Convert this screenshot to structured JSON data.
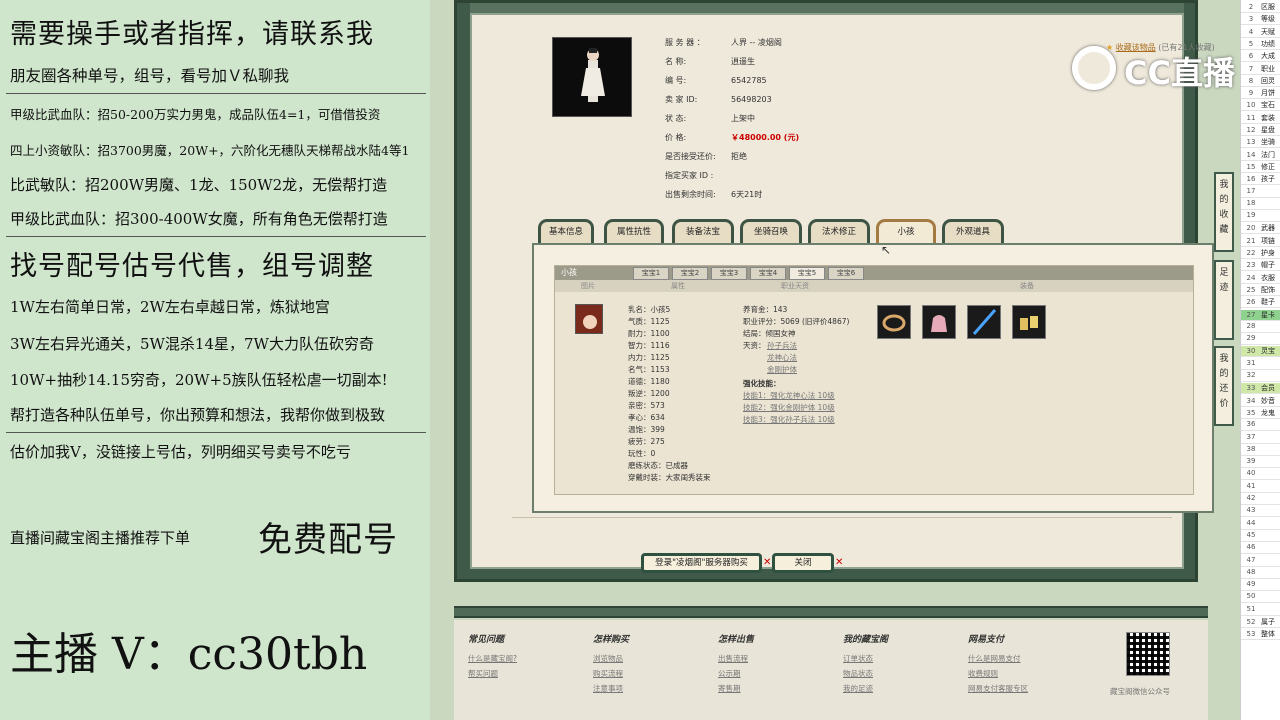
{
  "left_panel": {
    "lines": [
      "需要操手或者指挥，请联系我",
      "朋友圈各种单号，组号，看号加Ｖ私聊我",
      "甲级比武血队：招50-200万实力男鬼，成品队伍4=1，可借借投资",
      "四上小资敏队：招3700男魔，20W+，六阶化无穗队天梯帮战水陆4等1",
      "比武敏队：招200W男魔、1龙、150W2龙，无偿帮打造",
      "甲级比武血队：招300-400W女魔，所有角色无偿帮打造",
      "找号配号估号代售，组号调整",
      "1W左右简单日常，2W左右卓越日常，炼狱地宫",
      "3W左右异光通关，5W混杀14星，7W大力队伍砍穷奇",
      "10W+抽秒14.15穷奇，20W+5族队伍轻松虐一切副本!",
      "帮打造各种队伍单号，你出预算和想法，我帮你做到极致",
      "估价加我V，没链接上号估，列明细买号卖号不吃亏",
      "直播间藏宝阁主播推荐下单",
      "免费配号",
      "主播 V：cc30tbh"
    ]
  },
  "listing": {
    "server": {
      "label": "服 务 器 ：",
      "value": "人界 -- 凌烟阁"
    },
    "name": {
      "label": "名          称:",
      "value": "逍遥生"
    },
    "number": {
      "label": "编          号:",
      "value": "6542785"
    },
    "seller_id": {
      "label": "卖   家   ID:",
      "value": "56498203"
    },
    "status": {
      "label": "状          态:",
      "value": "上架中"
    },
    "price": {
      "label": "价          格:",
      "value": "￥48000.00 (元)"
    },
    "counter_offer": {
      "label": "是否接受还价:",
      "value": "拒绝"
    },
    "buyer_id": {
      "label": "指定买家 ID :",
      "value": ""
    },
    "remaining": {
      "label": "出售剩余时间:",
      "value": "6天21时"
    },
    "fav_link": "收藏该物品",
    "fav_count": "(已有21人收藏)"
  },
  "tabs": [
    "基本信息",
    "属性抗性",
    "装备法宝",
    "坐骑召唤兽",
    "法术修正",
    "小孩",
    "外观道具"
  ],
  "child_panel": {
    "title": "小孩",
    "sub_tabs": [
      "宝宝1",
      "宝宝2",
      "宝宝3",
      "宝宝4",
      "宝宝5",
      "宝宝6"
    ],
    "headers": [
      "图片",
      "属性",
      "职业天资",
      "装备"
    ],
    "stats_left": [
      "乳名：小孩5",
      "气质：1125",
      "耐力：1100",
      "智力：1116",
      "内力：1125",
      "名气：1153",
      "道德：1180",
      "叛逆：1200",
      "亲密：573",
      "孝心：634",
      "温饱：399",
      "疲劳：275",
      "玩性：0",
      "磨练状态：已成器",
      "穿戴时装：大家闺秀装束"
    ],
    "stats_right": [
      "养育金：143",
      "职业评分：5069 (旧评价4867)",
      "结局：倾国女神",
      "天资："
    ],
    "talents": [
      "孙子兵法",
      "龙神心法",
      "金刚护体"
    ],
    "skills_label": "强化技能：",
    "skills": [
      "技能1：强化龙神心法 10级",
      "技能2：强化金刚护体 10级",
      "技能3：强化孙子兵法 10级"
    ]
  },
  "buttons": {
    "buy": "登录\"凌烟阁\"服务器购买",
    "close": "关闭"
  },
  "side_tabs": [
    "我的收藏",
    "足迹",
    "我的还价"
  ],
  "footer": {
    "cols": [
      {
        "title": "常见问题",
        "links": [
          "什么是藏宝阁?",
          "帮买问题"
        ]
      },
      {
        "title": "怎样购买",
        "links": [
          "浏览物品",
          "购买流程",
          "注意事项"
        ]
      },
      {
        "title": "怎样出售",
        "links": [
          "出售流程",
          "公示期",
          "寄售期"
        ]
      },
      {
        "title": "我的藏宝阁",
        "links": [
          "订单状态",
          "物品状态",
          "我的足迹"
        ]
      },
      {
        "title": "网易支付",
        "links": [
          "什么是网易支付",
          "收费规则",
          "网易支付客服专区"
        ]
      }
    ],
    "qr_label": "藏宝阁微信公众号"
  },
  "logo": "CC直播",
  "sheet_rows": [
    {
      "n": "2",
      "t": "区服"
    },
    {
      "n": "3",
      "t": "等级"
    },
    {
      "n": "4",
      "t": "天赋"
    },
    {
      "n": "5",
      "t": "功绩"
    },
    {
      "n": "6",
      "t": "大成"
    },
    {
      "n": "7",
      "t": "职业"
    },
    {
      "n": "8",
      "t": "回灵"
    },
    {
      "n": "9",
      "t": "月饼"
    },
    {
      "n": "10",
      "t": "宝石"
    },
    {
      "n": "11",
      "t": "套装"
    },
    {
      "n": "12",
      "t": "星盘"
    },
    {
      "n": "13",
      "t": "坐骑"
    },
    {
      "n": "14",
      "t": "法门"
    },
    {
      "n": "15",
      "t": "修正"
    },
    {
      "n": "16",
      "t": "孩子"
    },
    {
      "n": "17",
      "t": ""
    },
    {
      "n": "18",
      "t": ""
    },
    {
      "n": "19",
      "t": ""
    },
    {
      "n": "20",
      "t": "武器"
    },
    {
      "n": "21",
      "t": "项链"
    },
    {
      "n": "22",
      "t": "护身"
    },
    {
      "n": "23",
      "t": "帽子"
    },
    {
      "n": "24",
      "t": "衣服"
    },
    {
      "n": "25",
      "t": "配饰"
    },
    {
      "n": "26",
      "t": "鞋子"
    },
    {
      "n": "27",
      "t": "星卡"
    },
    {
      "n": "28",
      "t": ""
    },
    {
      "n": "29",
      "t": ""
    },
    {
      "n": "30",
      "t": "灵宝"
    },
    {
      "n": "31",
      "t": ""
    },
    {
      "n": "32",
      "t": ""
    },
    {
      "n": "33",
      "t": "会员"
    },
    {
      "n": "34",
      "t": "妙音"
    },
    {
      "n": "35",
      "t": "龙鬼"
    },
    {
      "n": "36",
      "t": ""
    },
    {
      "n": "37",
      "t": ""
    },
    {
      "n": "38",
      "t": ""
    },
    {
      "n": "39",
      "t": ""
    },
    {
      "n": "40",
      "t": ""
    },
    {
      "n": "41",
      "t": ""
    },
    {
      "n": "42",
      "t": ""
    },
    {
      "n": "43",
      "t": ""
    },
    {
      "n": "44",
      "t": ""
    },
    {
      "n": "45",
      "t": ""
    },
    {
      "n": "46",
      "t": ""
    },
    {
      "n": "47",
      "t": ""
    },
    {
      "n": "48",
      "t": ""
    },
    {
      "n": "49",
      "t": ""
    },
    {
      "n": "50",
      "t": ""
    },
    {
      "n": "51",
      "t": ""
    },
    {
      "n": "52",
      "t": "属子"
    },
    {
      "n": "53",
      "t": "整体"
    }
  ],
  "colors": {
    "price": "#cc0000",
    "frame": "#3f5a48",
    "left_bg": "#cfe6cc"
  }
}
